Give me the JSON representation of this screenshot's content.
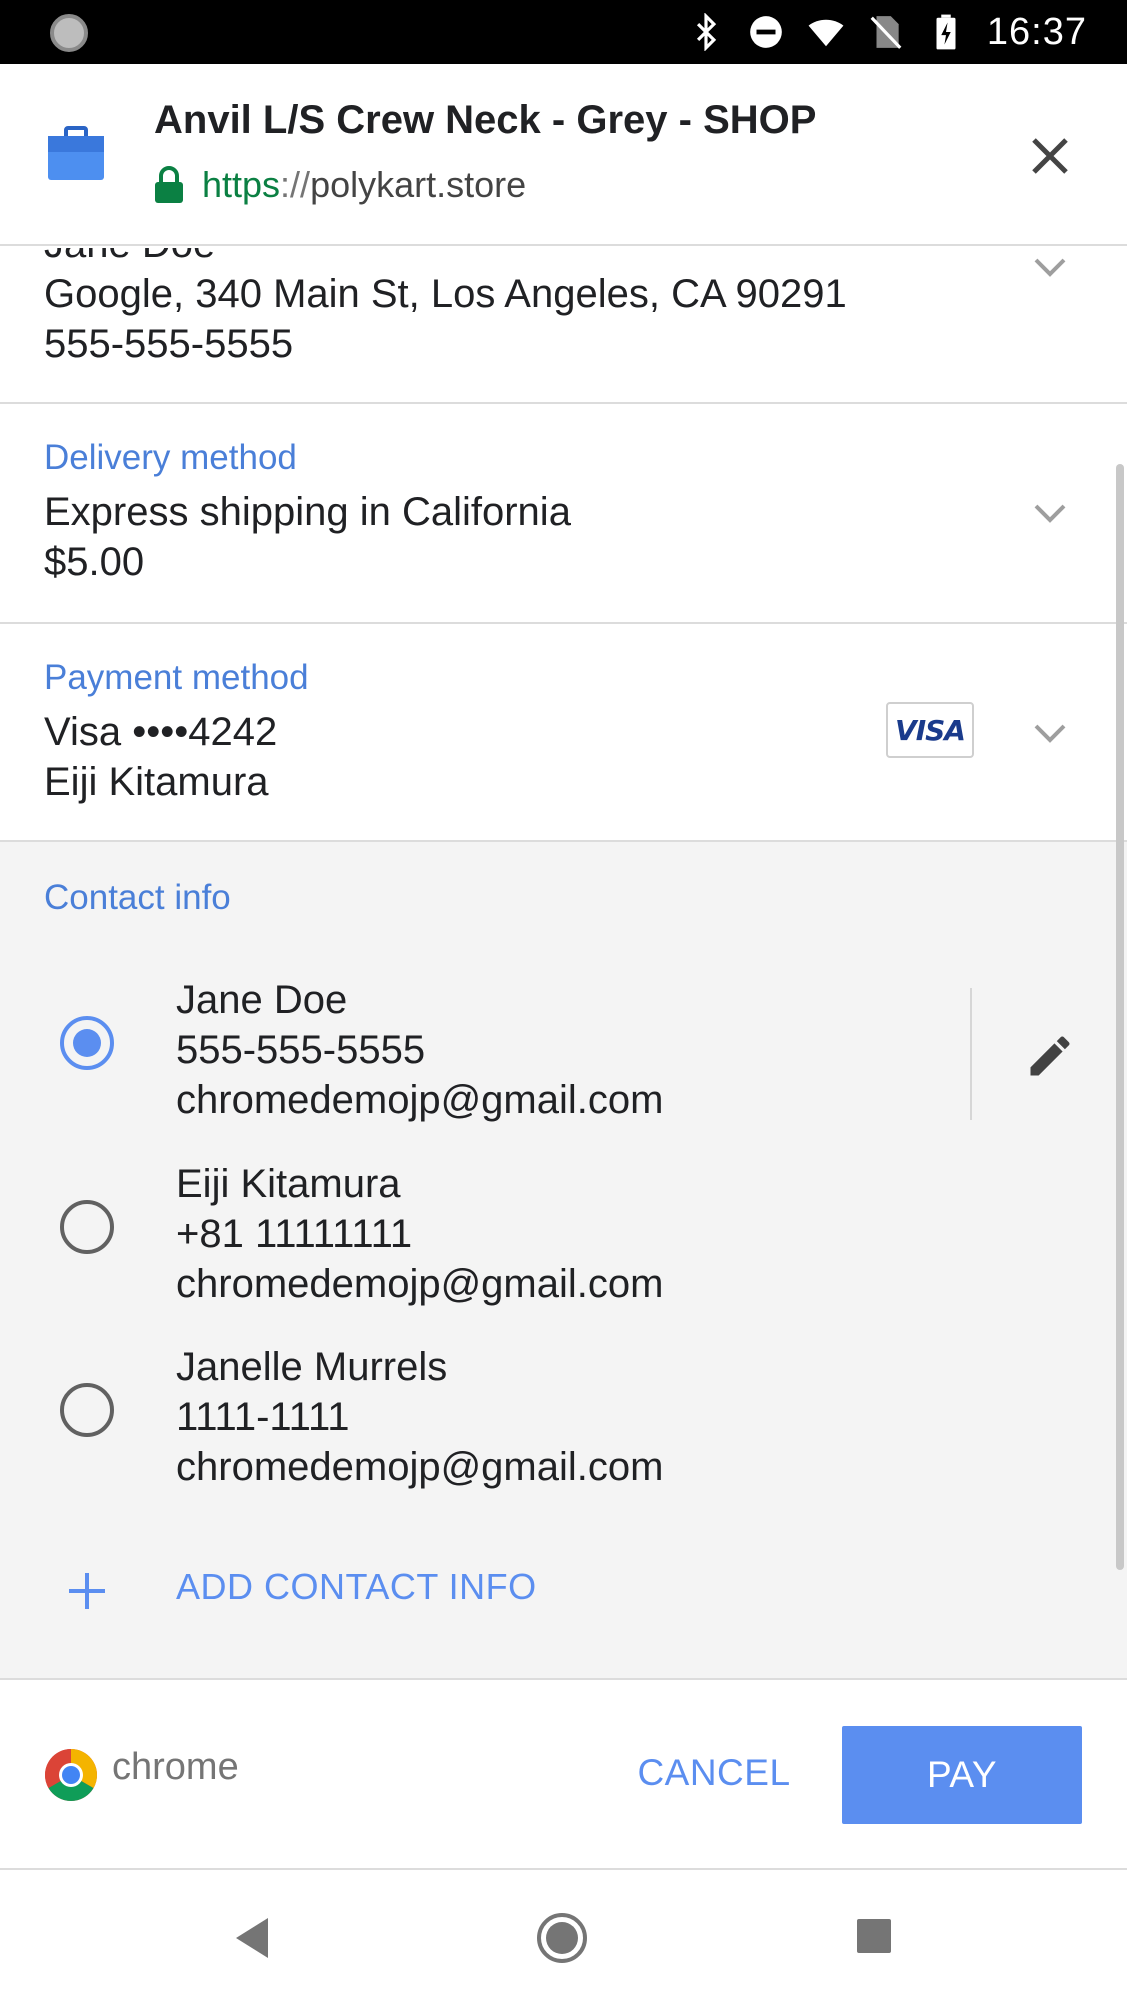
{
  "status_bar": {
    "time": "16:37"
  },
  "header": {
    "title": "Anvil L/S Crew Neck - Grey - SHOP",
    "url_scheme": "https",
    "url_separator": "://",
    "url_host": "polykart.store"
  },
  "shipping": {
    "name_partial": "Jane Doe",
    "address": "Google, 340 Main St, Los Angeles, CA 90291",
    "phone": "555-555-5555"
  },
  "delivery": {
    "label": "Delivery method",
    "option": "Express shipping in California",
    "price": "$5.00"
  },
  "payment": {
    "label": "Payment method",
    "card": "Visa  ••••4242",
    "holder": "Eiji Kitamura",
    "card_brand": "VISA"
  },
  "contact": {
    "label": "Contact info",
    "items": [
      {
        "name": "Jane Doe",
        "phone": "555-555-5555",
        "email": "chromedemojp@gmail.com",
        "selected": true
      },
      {
        "name": "Eiji Kitamura",
        "phone": "+81 11111111",
        "email": "chromedemojp@gmail.com",
        "selected": false
      },
      {
        "name": "Janelle Murrels",
        "phone": "1111-1111",
        "email": "chromedemojp@gmail.com",
        "selected": false
      }
    ],
    "add_label": "ADD CONTACT INFO"
  },
  "footer": {
    "brand": "chrome",
    "cancel_label": "CANCEL",
    "pay_label": "PAY"
  },
  "colors": {
    "accent": "#5b8ef0",
    "section_label": "#4a7fd8",
    "secure_green": "#0b8043"
  },
  "icons": [
    "shop-bag-icon",
    "lock-icon",
    "close-icon",
    "chevron-down-icon",
    "visa-card-icon",
    "edit-pencil-icon",
    "plus-icon",
    "chrome-logo-icon",
    "nav-back-icon",
    "nav-home-icon",
    "nav-recents-icon"
  ]
}
